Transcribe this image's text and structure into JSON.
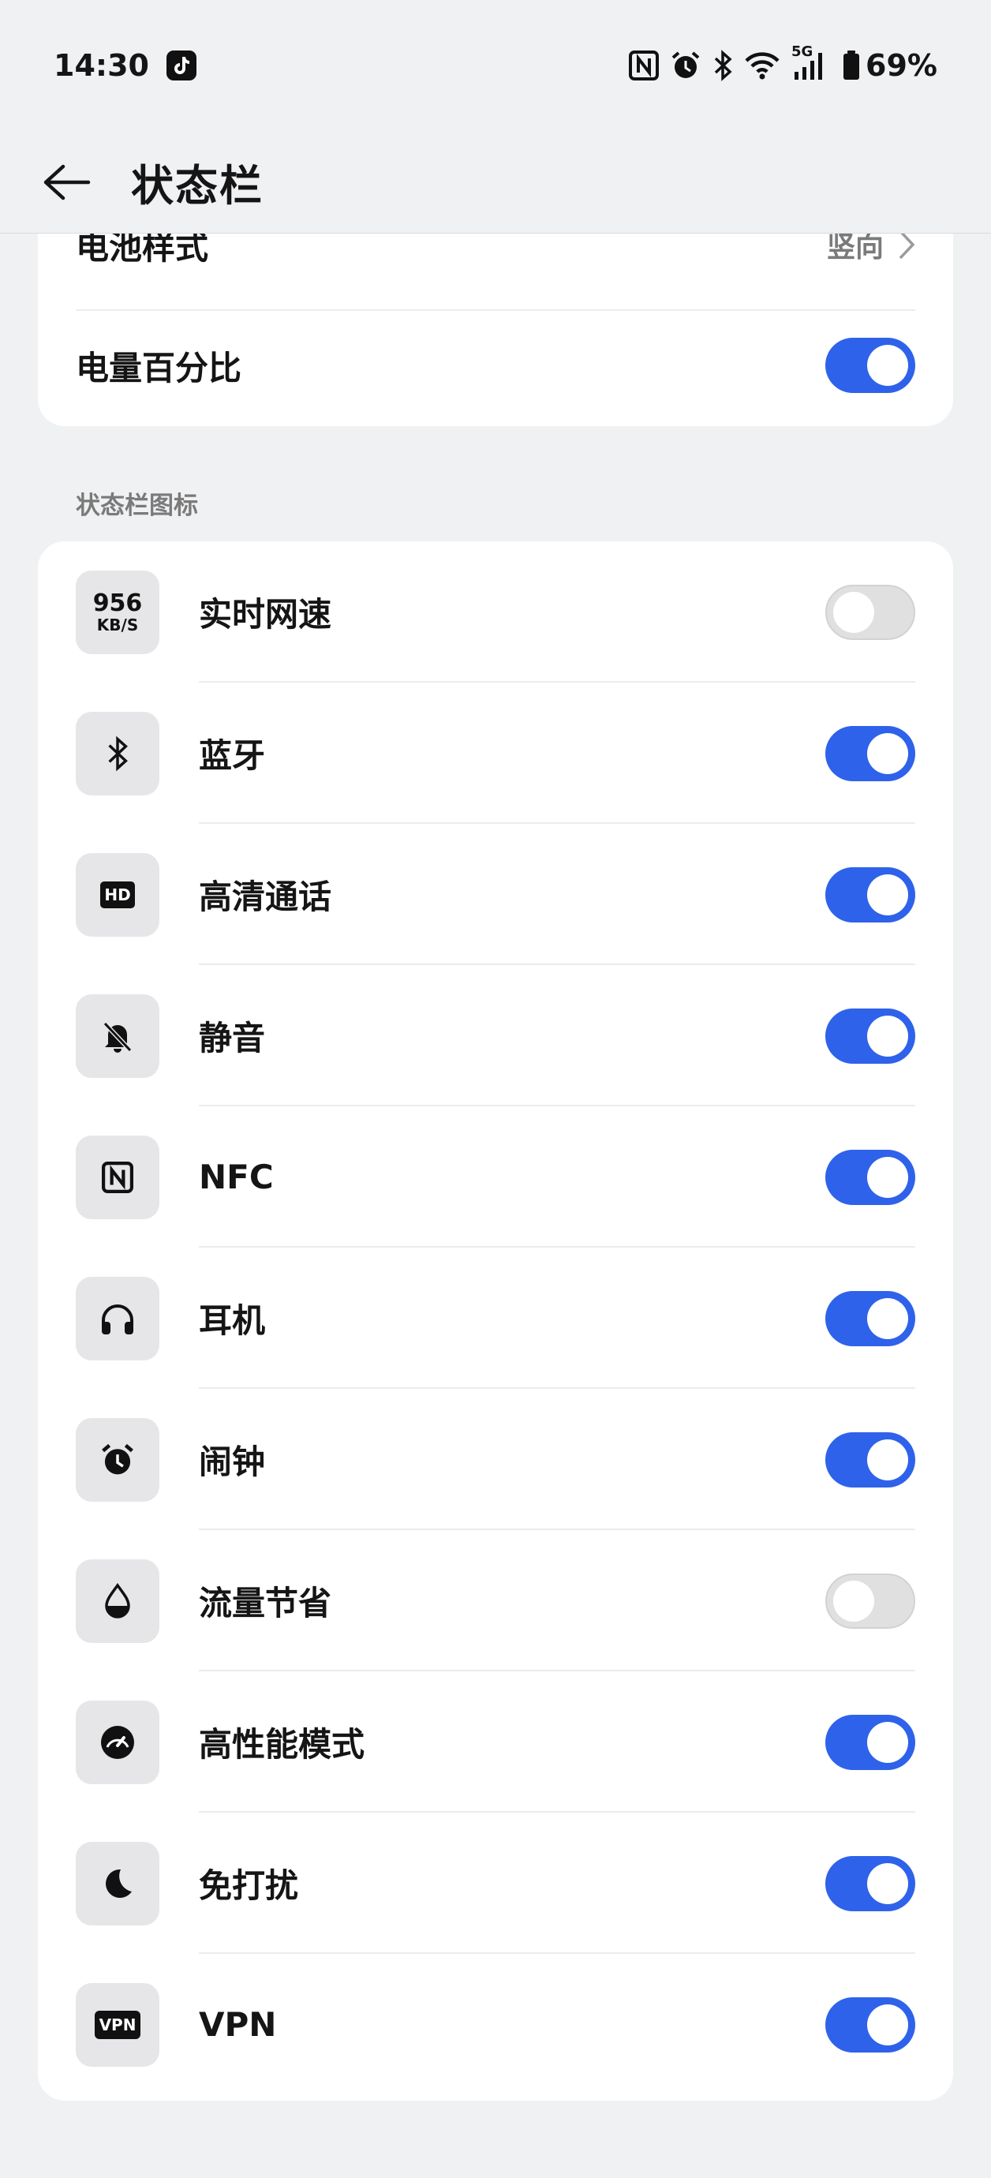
{
  "status_bar": {
    "time": "14:30",
    "battery_percent": "69%",
    "network_label": "5G",
    "icons": [
      "tiktok-icon",
      "nfc-icon",
      "alarm-icon",
      "bluetooth-icon",
      "wifi-icon",
      "signal-icon",
      "battery-icon"
    ]
  },
  "header": {
    "title": "状态栏"
  },
  "top_card": {
    "battery_style_label": "电池样式",
    "battery_style_value": "竖向",
    "battery_percent_label": "电量百分比",
    "battery_percent_on": true
  },
  "section": {
    "label": "状态栏图标"
  },
  "items": [
    {
      "label": "实时网速",
      "icon": "network-speed-icon",
      "icon_text_top": "956",
      "icon_text_bottom": "KB/S",
      "on": false
    },
    {
      "label": "蓝牙",
      "icon": "bluetooth-icon",
      "on": true
    },
    {
      "label": "高清通话",
      "icon": "hd-icon",
      "icon_text_top": "HD",
      "on": true
    },
    {
      "label": "静音",
      "icon": "mute-bell-icon",
      "on": true
    },
    {
      "label": "NFC",
      "icon": "nfc-icon",
      "on": true
    },
    {
      "label": "耳机",
      "icon": "headphones-icon",
      "on": true
    },
    {
      "label": "闹钟",
      "icon": "alarm-icon",
      "on": true
    },
    {
      "label": "流量节省",
      "icon": "data-saver-icon",
      "on": false
    },
    {
      "label": "高性能模式",
      "icon": "performance-gauge-icon",
      "on": true
    },
    {
      "label": "免打扰",
      "icon": "moon-icon",
      "on": true
    },
    {
      "label": "VPN",
      "icon": "vpn-icon",
      "icon_text_top": "VPN",
      "on": true
    }
  ],
  "colors": {
    "accent": "#2f62ea",
    "background": "#f0f1f3",
    "card": "#ffffff",
    "toggle_off": "#e0e0e0"
  }
}
